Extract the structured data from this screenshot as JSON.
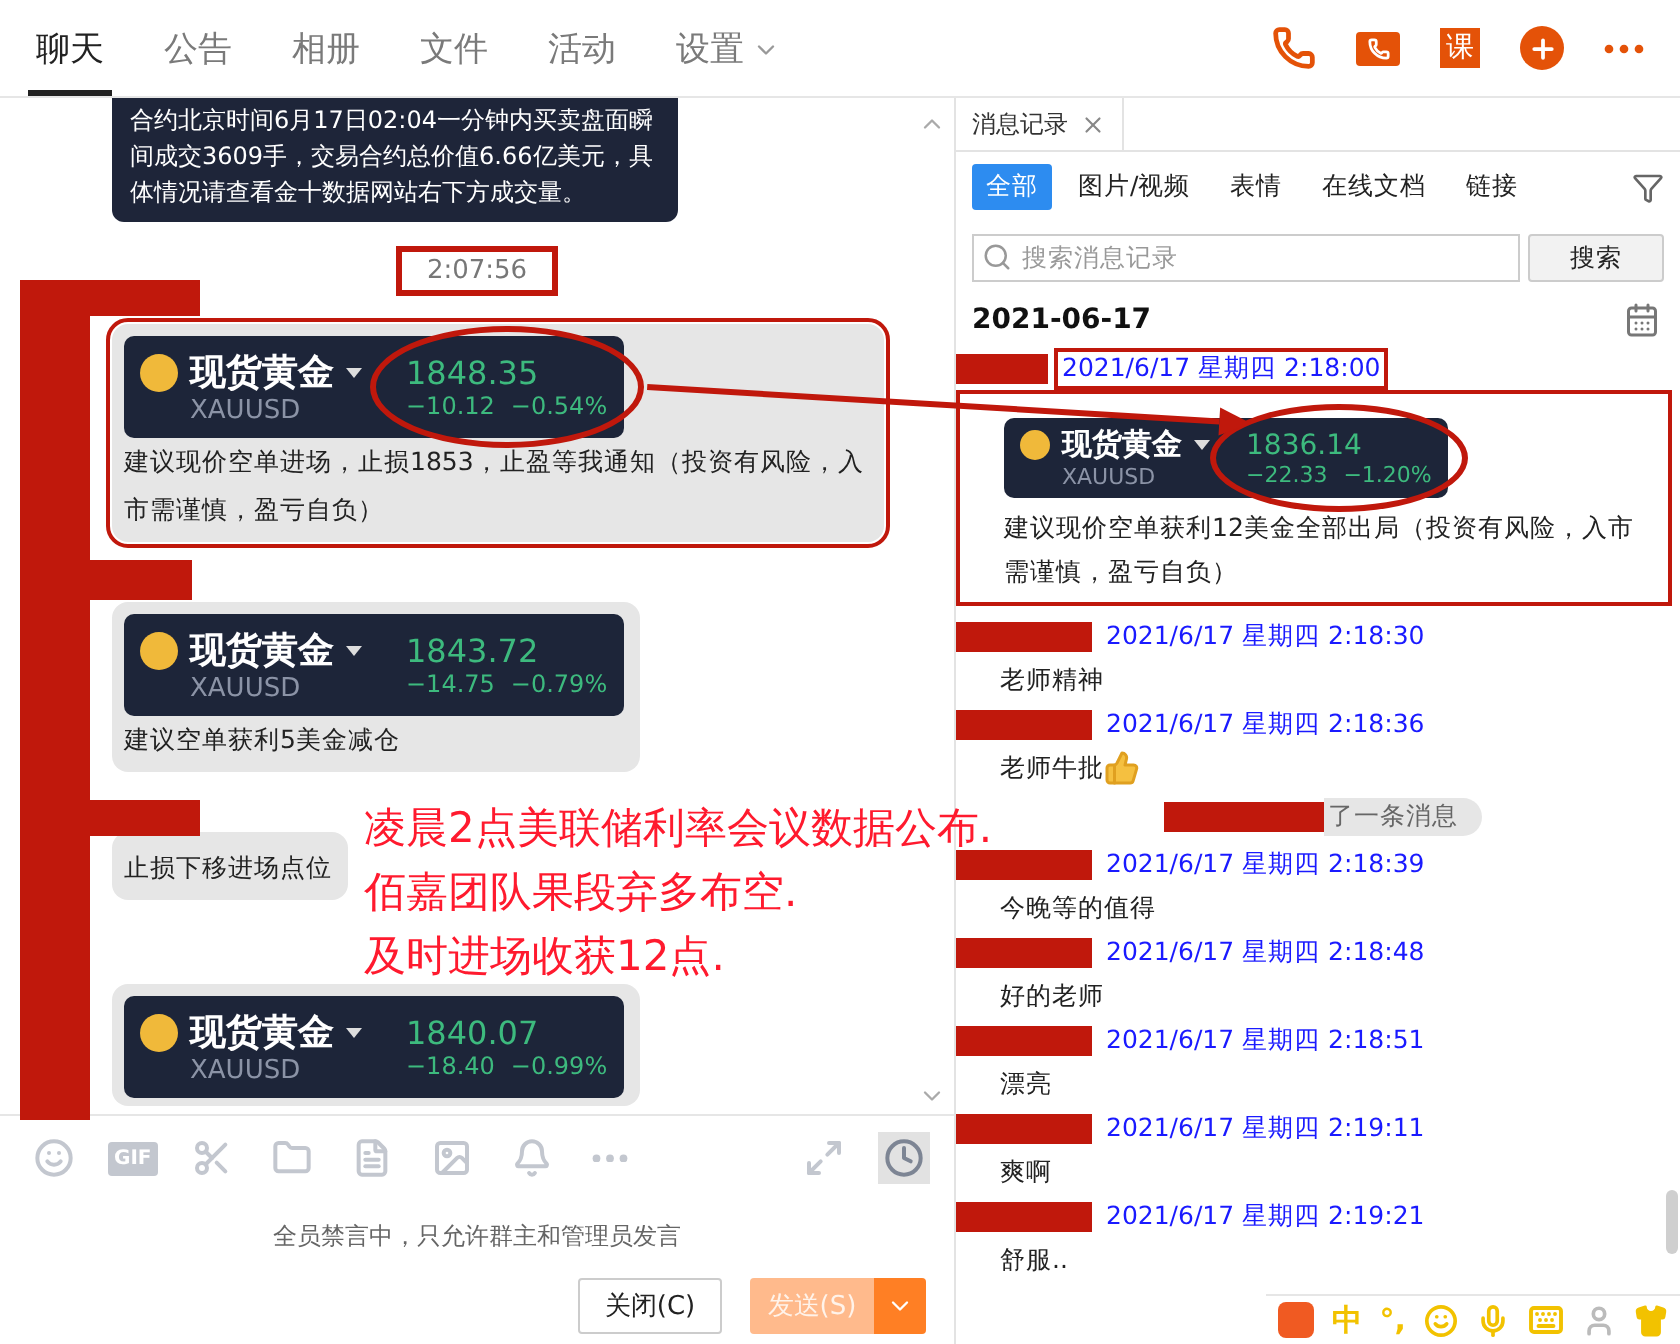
{
  "tabs": [
    {
      "label": "聊天",
      "selected": true
    },
    {
      "label": "公告",
      "selected": false
    },
    {
      "label": "相册",
      "selected": false
    },
    {
      "label": "文件",
      "selected": false
    },
    {
      "label": "活动",
      "selected": false
    },
    {
      "label": "设置",
      "selected": false,
      "dropdown": true
    }
  ],
  "header_actions": [
    {
      "kind": "phone"
    },
    {
      "kind": "video"
    },
    {
      "kind": "course",
      "label": "课"
    },
    {
      "kind": "add"
    },
    {
      "kind": "more"
    }
  ],
  "chat": {
    "messages": [
      {
        "kind": "notice",
        "text": "合约北京时间6月17日02:04一分钟内买卖盘面瞬间成交3609手，交易合约总价值6.66亿美元，具体情况请查看金十数据网站右下方成交量。"
      },
      {
        "kind": "time",
        "text": "2:07:56",
        "framed": true
      },
      {
        "kind": "quote",
        "name": "现货黄金",
        "symbol": "XAUUSD",
        "price": "1848.35",
        "change": "−10.12",
        "percent": "−0.54%",
        "text": "建议现价空单进场，止损1853，止盈等我通知（投资有风险，入市需谨慎，盈亏自负）",
        "framed": true,
        "circled": true
      },
      {
        "kind": "quote",
        "name": "现货黄金",
        "symbol": "XAUUSD",
        "price": "1843.72",
        "change": "−14.75",
        "percent": "−0.79%",
        "text": "建议空单获利5美金减仓"
      },
      {
        "kind": "text",
        "text": "止损下移进场点位"
      },
      {
        "kind": "quote",
        "name": "现货黄金",
        "symbol": "XAUUSD",
        "price": "1840.07",
        "change": "−18.40",
        "percent": "−0.99%"
      }
    ]
  },
  "annotation": {
    "lines": [
      "凌晨2点美联储利率会议数据公布.",
      "佰嘉团队果段弃多布空.",
      "及时进场收获12点."
    ]
  },
  "composer": {
    "tools": [
      {
        "kind": "emoji"
      },
      {
        "kind": "gif",
        "label": "GIF"
      },
      {
        "kind": "cut"
      },
      {
        "kind": "folder"
      },
      {
        "kind": "doc"
      },
      {
        "kind": "image"
      },
      {
        "kind": "bell"
      },
      {
        "kind": "more"
      }
    ],
    "side_tools": [
      {
        "kind": "expand",
        "selected": false
      },
      {
        "kind": "history",
        "selected": true
      }
    ],
    "notice": "全员禁言中，只允许群主和管理员发言",
    "close": "关闭(C)",
    "send": {
      "label": "发送(S)",
      "disabled": true
    }
  },
  "history": {
    "title": "消息记录",
    "filters": [
      {
        "label": "全部",
        "selected": true
      },
      {
        "label": "图片/视频",
        "selected": false
      },
      {
        "label": "表情",
        "selected": false
      },
      {
        "label": "在线文档",
        "selected": false
      },
      {
        "label": "链接",
        "selected": false
      }
    ],
    "search": {
      "placeholder": "搜索消息记录",
      "button": "搜索"
    },
    "date": "2021-06-17",
    "entries": [
      {
        "kind": "quote",
        "time": "2021/6/17 星期四 2:18:00",
        "name": "现货黄金",
        "symbol": "XAUUSD",
        "price": "1836.14",
        "change": "−22.33",
        "percent": "−1.20%",
        "text": "建议现价空单获利12美金全部出局（投资有风险，入市需谨慎，盈亏自负）",
        "framed": true,
        "circled": true
      },
      {
        "kind": "text",
        "time": "2021/6/17 星期四 2:18:30",
        "text": "老师精神"
      },
      {
        "kind": "text",
        "time": "2021/6/17 星期四 2:18:36",
        "text": "老师牛批",
        "sticker": true
      },
      {
        "kind": "system",
        "text": "了一条消息"
      },
      {
        "kind": "text",
        "time": "2021/6/17 星期四 2:18:39",
        "text": "今晚等的值得"
      },
      {
        "kind": "text",
        "time": "2021/6/17 星期四 2:18:48",
        "text": "好的老师"
      },
      {
        "kind": "text",
        "time": "2021/6/17 星期四 2:18:51",
        "text": "漂亮"
      },
      {
        "kind": "text",
        "time": "2021/6/17 星期四 2:19:11",
        "text": "爽啊"
      },
      {
        "kind": "text",
        "time": "2021/6/17 星期四 2:19:21",
        "text": "舒服.."
      }
    ]
  },
  "ime": {
    "mode": "中",
    "punct": "°,"
  }
}
